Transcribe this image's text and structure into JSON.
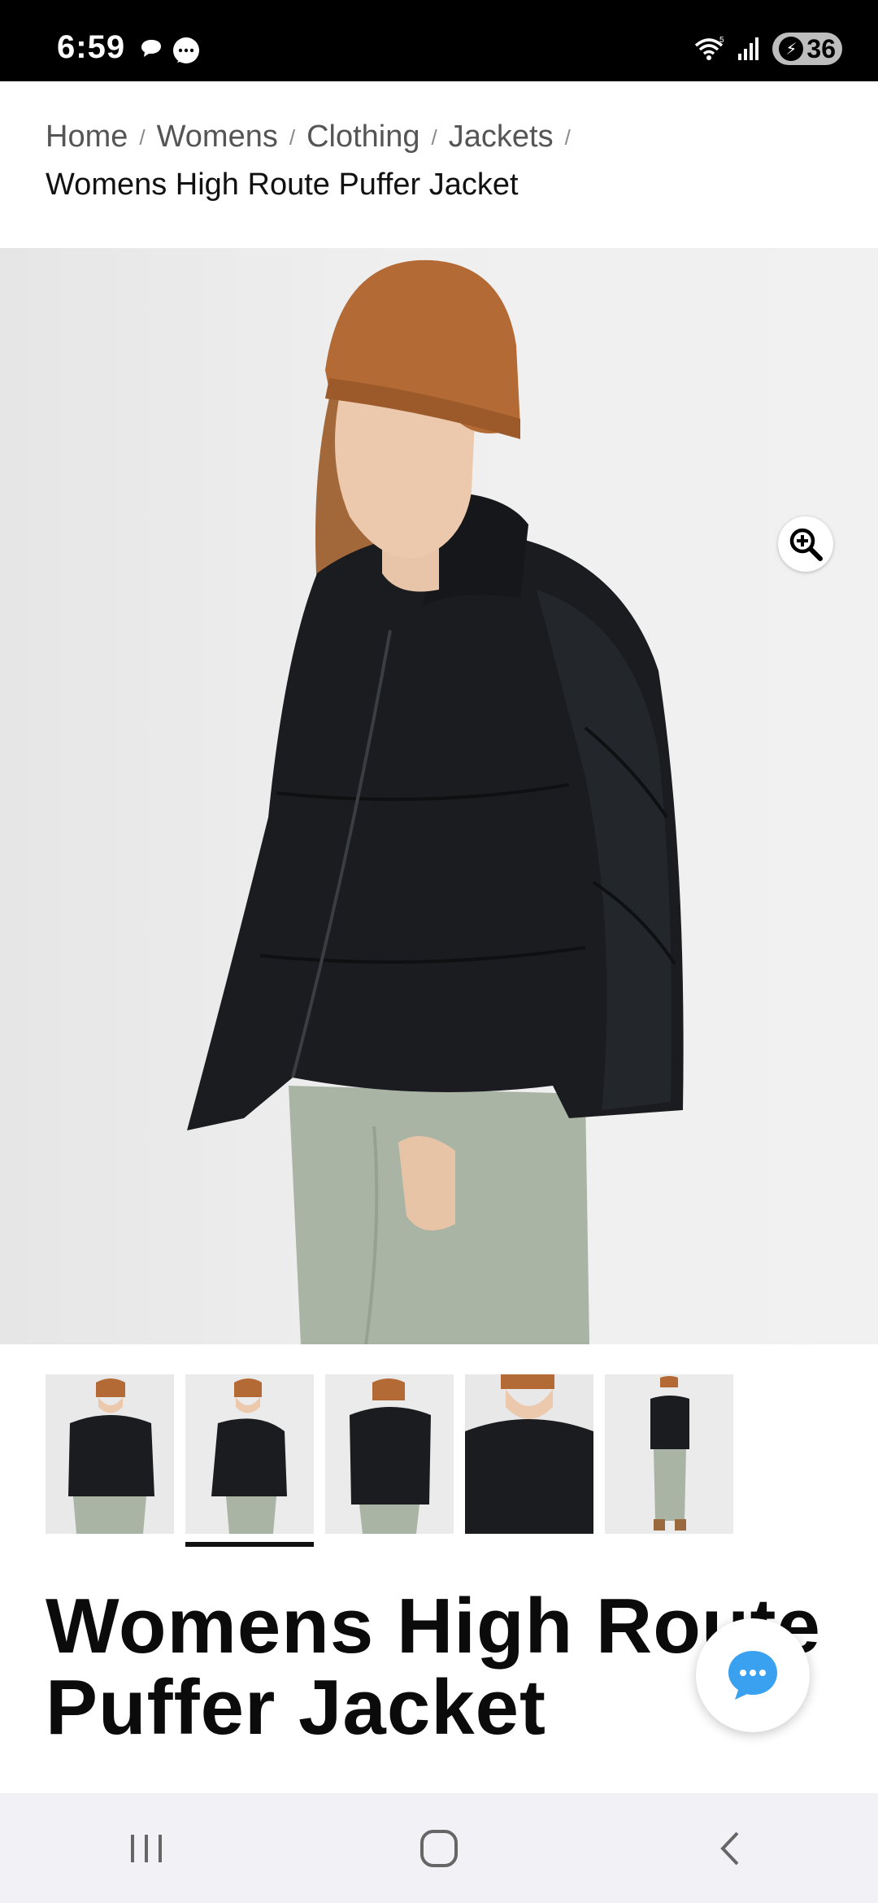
{
  "status_bar": {
    "time": "6:59",
    "battery": "36",
    "icons": [
      "chat-bubble-icon",
      "messages-icon",
      "wifi-icon",
      "signal-icon",
      "battery-charging-icon"
    ]
  },
  "breadcrumb": {
    "items": [
      "Home",
      "Womens",
      "Clothing",
      "Jackets"
    ],
    "separator": "/",
    "current": "Womens High Route Puffer Jacket"
  },
  "gallery": {
    "zoom_icon": "zoom-in-icon",
    "thumbnail_count": 5,
    "selected_index": 1
  },
  "product": {
    "title_line1": "Womens High Route",
    "title_line2": "Puffer Jacket"
  },
  "chat": {
    "icon": "chat-icon"
  },
  "navigation": {
    "buttons": [
      "recent-apps-icon",
      "home-icon",
      "back-icon"
    ]
  },
  "colors": {
    "accent_chat": "#3aa0f0",
    "text_primary": "#111111",
    "text_secondary": "#555555",
    "jacket": "#1a1c1f",
    "beanie": "#b36a35",
    "pants": "#a7b3a3"
  }
}
